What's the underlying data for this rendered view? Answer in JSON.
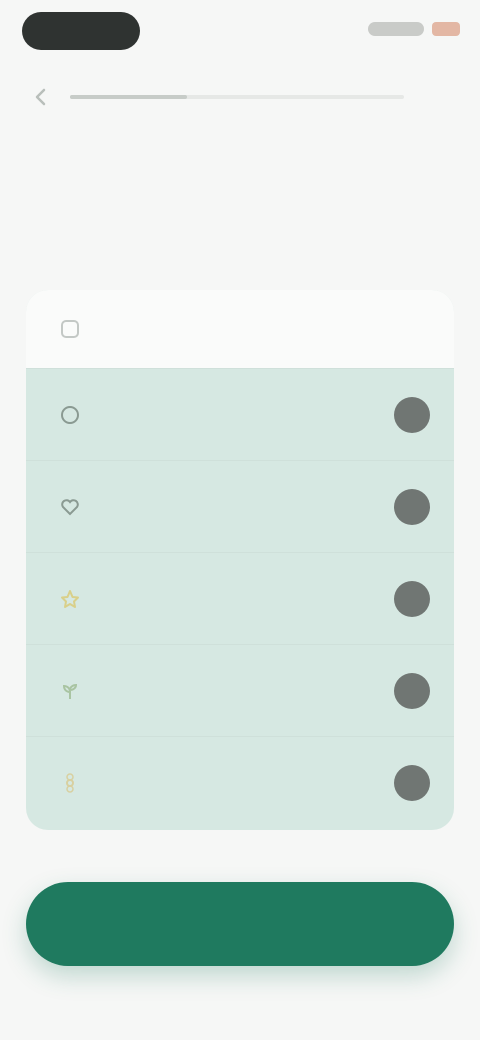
{
  "status": {
    "accent_battery": "#e3b7a4"
  },
  "nav": {
    "back_icon": "arrow-left-icon",
    "progress_fraction": 0.35,
    "skip_label": ""
  },
  "question": {
    "title": ""
  },
  "card": {
    "header_label": "",
    "header_icon": "info-icon",
    "options": [
      {
        "label": "",
        "icon": "leaf-icon",
        "icon_color": "#8a9a92"
      },
      {
        "label": "",
        "icon": "heart-icon",
        "icon_color": "#8a9a92"
      },
      {
        "label": "",
        "icon": "star-icon",
        "icon_color": "#d9d08a"
      },
      {
        "label": "",
        "icon": "sprout-icon",
        "icon_color": "#a9c4a2"
      },
      {
        "label": "",
        "icon": "flower-icon",
        "icon_color": "#d8d0a0"
      }
    ]
  },
  "continue_button": {
    "label": "",
    "color": "#1f7a5f"
  }
}
